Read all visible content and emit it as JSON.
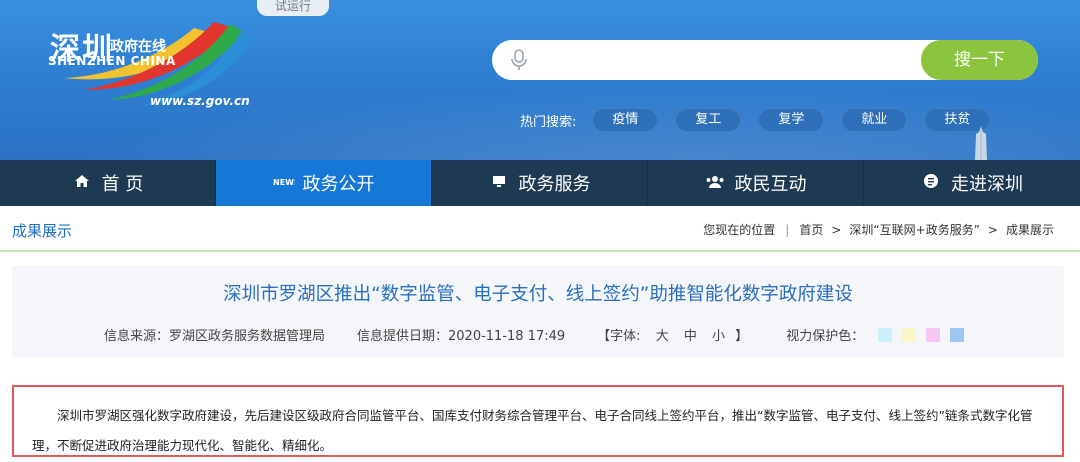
{
  "header": {
    "trial_badge": "试运行",
    "logo": {
      "cn_big": "深圳",
      "cn_small": "政府在线",
      "en": "SHENZHEN CHINA",
      "url": "www.sz.gov.cn"
    },
    "search": {
      "placeholder": "",
      "value": "",
      "button_label": "搜一下"
    },
    "hot": {
      "label": "热门搜索:",
      "tags": [
        "疫情",
        "复工",
        "复学",
        "就业",
        "扶贫"
      ]
    }
  },
  "nav": {
    "items": [
      {
        "label": "首 页",
        "icon": "home-icon"
      },
      {
        "label": "政务公开",
        "icon": "news-icon"
      },
      {
        "label": "政务服务",
        "icon": "monitor-icon"
      },
      {
        "label": "政民互动",
        "icon": "people-icon"
      },
      {
        "label": "走进深圳",
        "icon": "info-icon"
      }
    ],
    "active_index": 1
  },
  "breadcrumb": {
    "section_title": "成果展示",
    "location_label": "您现在的位置",
    "items": [
      "首页",
      "深圳“互联网+政务服务”",
      "成果展示"
    ]
  },
  "article": {
    "title": "深圳市罗湖区推出“数字监管、电子支付、线上签约”助推智能化数字政府建设",
    "source": "信息来源：罗湖区政务服务数据管理局",
    "date": "信息提供日期：2020-11-18 17:49",
    "font_label": "【字体:",
    "font_large": "大",
    "font_medium": "中",
    "font_small": "小",
    "font_close": "】",
    "eye_label": "视力保护色：",
    "eye_colors": [
      "#c9f0fb",
      "#fbf7c4",
      "#f7c6f3",
      "#9dc6f2"
    ],
    "summary": "深圳市罗湖区强化数字政府建设，先后建设区级政府合同监管平台、国库支付财务综合管理平台、电子合同线上签约平台，推出“数字监管、电子支付、线上签约”链条式数字化管理，不断促进政府治理能力现代化、智能化、精细化。"
  },
  "colors": {
    "banner_blue": "#2f7fd3",
    "nav_dark": "#1e3a52",
    "nav_active": "#1678d6",
    "search_green": "#8bc53f",
    "title_blue": "#2a6fbd",
    "summary_border": "#e05a5a"
  }
}
